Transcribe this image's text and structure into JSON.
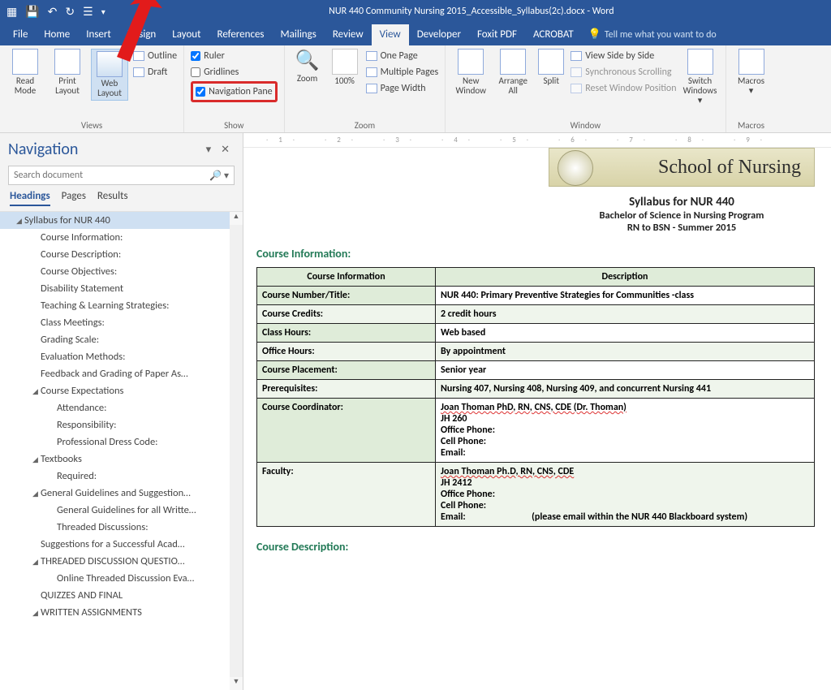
{
  "titlebar": {
    "doc_title": "NUR 440 Community Nursing 2015_Accessible_Syllabus(2c).docx - Word"
  },
  "menu": {
    "file": "File",
    "home": "Home",
    "insert": "Insert",
    "design": "Design",
    "layout": "Layout",
    "references": "References",
    "mailings": "Mailings",
    "review": "Review",
    "view": "View",
    "developer": "Developer",
    "foxit": "Foxit PDF",
    "acrobat": "ACROBAT",
    "tellme": "Tell me what you want to do"
  },
  "ribbon": {
    "views": {
      "label": "Views",
      "read": "Read Mode",
      "print": "Print Layout",
      "web": "Web Layout",
      "outline": "Outline",
      "draft": "Draft"
    },
    "show": {
      "label": "Show",
      "ruler": "Ruler",
      "gridlines": "Gridlines",
      "navpane": "Navigation Pane"
    },
    "zoom": {
      "label": "Zoom",
      "zoom": "Zoom",
      "pct": "100%",
      "one": "One Page",
      "multi": "Multiple Pages",
      "width": "Page Width"
    },
    "window": {
      "label": "Window",
      "new": "New Window",
      "arrange": "Arrange All",
      "split": "Split",
      "side": "View Side by Side",
      "sync": "Synchronous Scrolling",
      "reset": "Reset Window Position",
      "switch": "Switch Windows"
    },
    "macros": {
      "label": "Macros",
      "macros": "Macros"
    }
  },
  "nav": {
    "title": "Navigation",
    "placeholder": "Search document",
    "tabs": {
      "headings": "Headings",
      "pages": "Pages",
      "results": "Results"
    },
    "items": [
      {
        "t": "Syllabus for NUR 440",
        "lvl": 1,
        "sel": true,
        "exp": true
      },
      {
        "t": "Course Information:",
        "lvl": 2
      },
      {
        "t": "Course Description:",
        "lvl": 2
      },
      {
        "t": "Course Objectives:",
        "lvl": 2
      },
      {
        "t": "Disability Statement",
        "lvl": 2
      },
      {
        "t": "Teaching & Learning Strategies:",
        "lvl": 2
      },
      {
        "t": "Class Meetings:",
        "lvl": 2
      },
      {
        "t": "Grading Scale:",
        "lvl": 2
      },
      {
        "t": "Evaluation Methods:",
        "lvl": 2
      },
      {
        "t": "Feedback and Grading of Paper As…",
        "lvl": 2
      },
      {
        "t": "Course Expectations",
        "lvl": 2,
        "exp": true
      },
      {
        "t": "Attendance:",
        "lvl": 3
      },
      {
        "t": "Responsibility:",
        "lvl": 3
      },
      {
        "t": "Professional Dress Code:",
        "lvl": 3
      },
      {
        "t": "Textbooks",
        "lvl": 2,
        "exp": true
      },
      {
        "t": "Required:",
        "lvl": 3
      },
      {
        "t": "General Guidelines and Suggestion…",
        "lvl": 2,
        "exp": true
      },
      {
        "t": "General Guidelines for all Writte…",
        "lvl": 3
      },
      {
        "t": "Threaded Discussions:",
        "lvl": 3
      },
      {
        "t": "Suggestions for a Successful Acad…",
        "lvl": 2
      },
      {
        "t": "THREADED DISCUSSION QUESTIO…",
        "lvl": 2,
        "exp": true
      },
      {
        "t": "Online Threaded Discussion Eva…",
        "lvl": 3
      },
      {
        "t": "QUIZZES AND FINAL",
        "lvl": 2
      },
      {
        "t": "WRITTEN ASSIGNMENTS",
        "lvl": 2,
        "exp": true
      }
    ]
  },
  "ruler": [
    "1",
    "2",
    "3",
    "4",
    "5",
    "6",
    "7",
    "8",
    "9"
  ],
  "doc": {
    "banner": "School of Nursing",
    "title": "Syllabus for NUR 440",
    "sub1": "Bachelor of Science in Nursing Program",
    "sub2": "RN to BSN  -  Summer 2015",
    "sect1": "Course Information:",
    "sect2": "Course Description:",
    "th1": "Course Information",
    "th2": "Description",
    "rows": [
      {
        "k": "Course Number/Title:",
        "v": "NUR 440: Primary Preventive Strategies for Communities -class"
      },
      {
        "k": "Course Credits:",
        "v": "2 credit hours",
        "alt": true
      },
      {
        "k": "Class Hours:",
        "v": "Web based"
      },
      {
        "k": "Office Hours:",
        "v": "By appointment",
        "alt": true
      },
      {
        "k": "Course Placement:",
        "v": "Senior year"
      },
      {
        "k": "Prerequisites:",
        "v": "Nursing 407, Nursing 408, Nursing 409, and concurrent Nursing 441",
        "alt": true
      }
    ],
    "coord": {
      "k": "Course Coordinator:",
      "name": "Joan Thoman PhD, RN, CNS, CDE (Dr. Thoman)",
      "l1": "JH 260",
      "l2": "Office Phone:",
      "l3": "Cell Phone:",
      "l4": "Email:"
    },
    "fac": {
      "k": "Faculty:",
      "name": "Joan Thoman Ph.D, RN, CNS, CDE",
      "l1": "JH 2412",
      "l2": "Office Phone:",
      "l3": "Cell Phone:",
      "l4a": "Email:",
      "l4b": "(please email within the NUR 440 Blackboard system)"
    }
  }
}
